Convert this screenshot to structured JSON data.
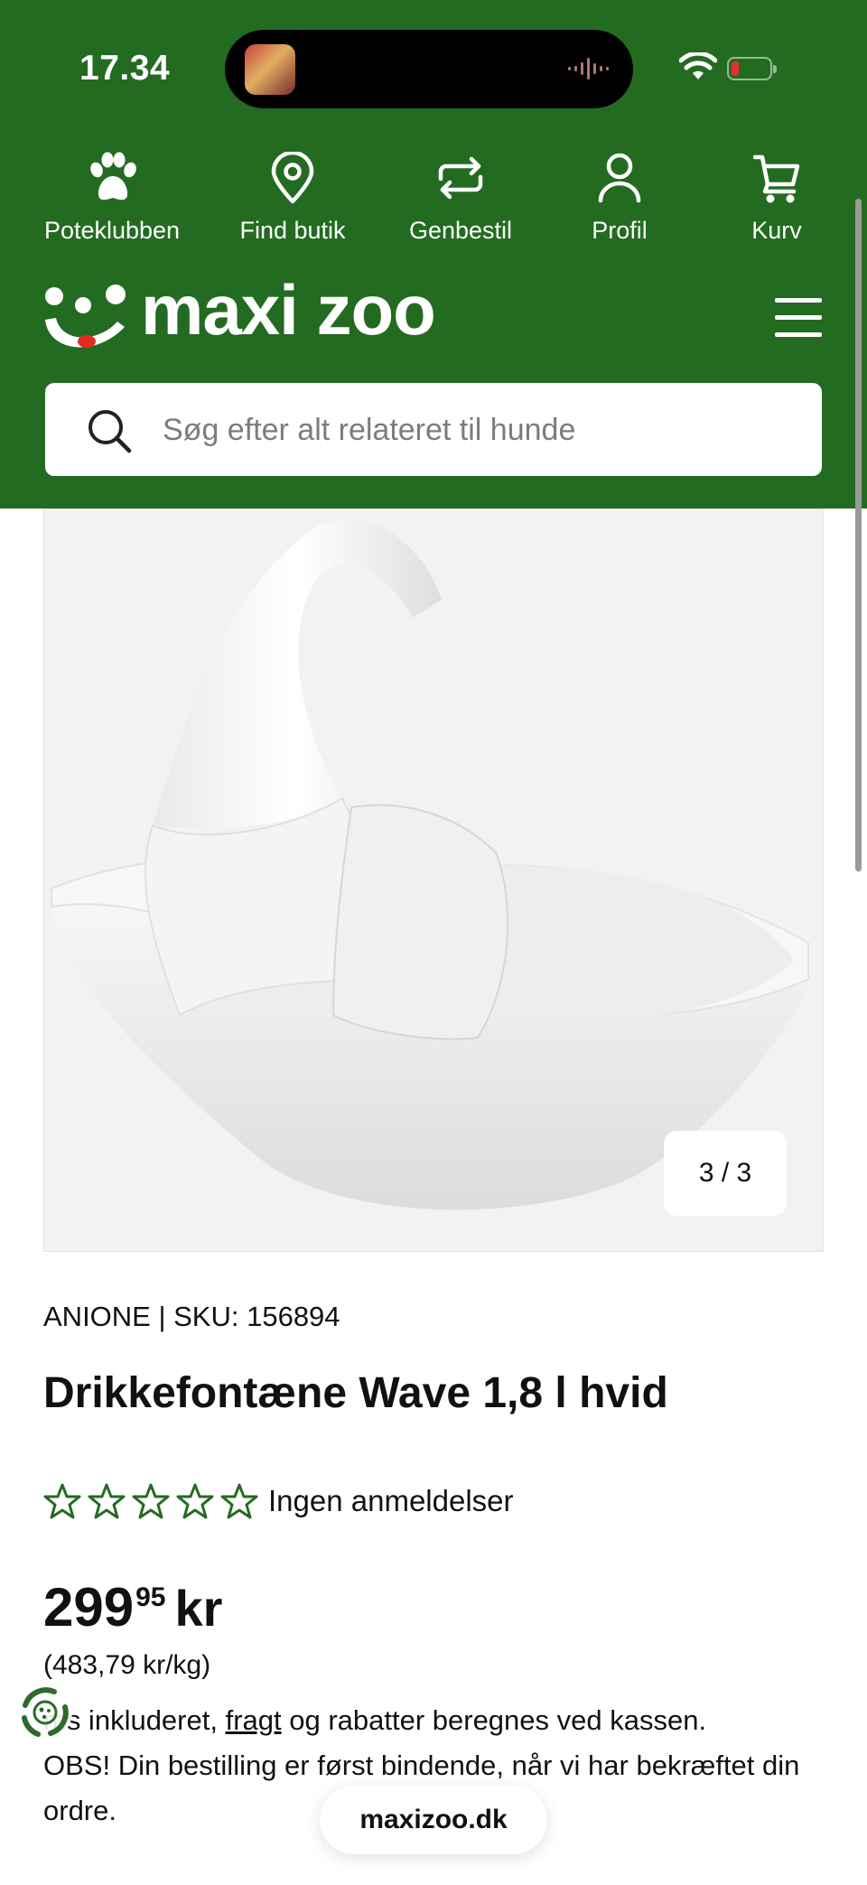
{
  "status_bar": {
    "time": "17.34"
  },
  "nav": {
    "items": [
      {
        "label": "Poteklubben",
        "icon": "paw-icon"
      },
      {
        "label": "Find butik",
        "icon": "map-pin-icon"
      },
      {
        "label": "Genbestil",
        "icon": "repeat-icon"
      },
      {
        "label": "Profil",
        "icon": "user-icon"
      },
      {
        "label": "Kurv",
        "icon": "cart-icon"
      }
    ]
  },
  "logo": {
    "text": "maxi zoo"
  },
  "search": {
    "placeholder": "Søg efter alt relateret til hunde"
  },
  "gallery": {
    "counter": "3 / 3"
  },
  "product": {
    "brand_sku": "ANIONE | SKU: 156894",
    "title": "Drikkefontæne Wave 1,8 l hvid",
    "rating_text": "Ingen anmeldelser",
    "rating_value": 0,
    "rating_max": 5,
    "price_main": "299",
    "price_cents": "95",
    "price_currency": "kr",
    "unit_price": "(483,79 kr/kg)"
  },
  "notes": {
    "line1_prefix": "ms inkluderet, ",
    "line1_link": "fragt",
    "line1_suffix": " og rabatter beregnes ved kassen.",
    "line2": "OBS! Din bestilling er først bindende, når vi har bekræftet din ordre."
  },
  "browser": {
    "domain": "maxizoo.dk"
  },
  "colors": {
    "brand_green": "#246b22",
    "star_outline": "#246b22"
  }
}
